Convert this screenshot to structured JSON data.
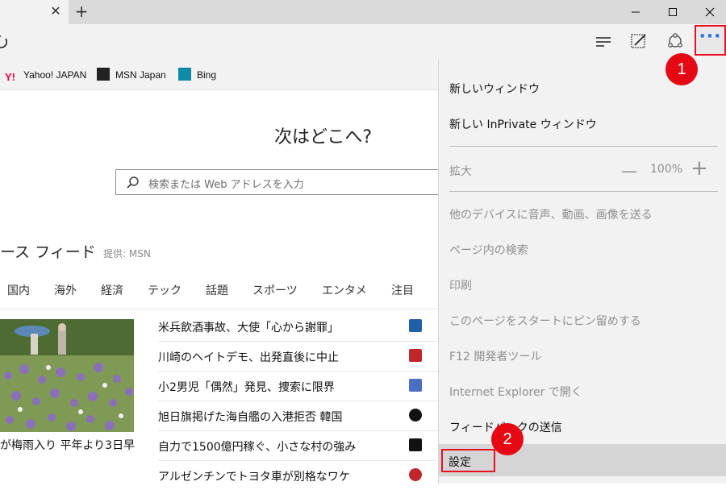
{
  "window": {
    "tab_close": "✕",
    "new_tab": "+"
  },
  "favorites": [
    {
      "label": "Yahoo! JAPAN",
      "icon": "yahoo-icon",
      "color": "#ff0033"
    },
    {
      "label": "MSN Japan",
      "icon": "msn-icon",
      "color": "#222222"
    },
    {
      "label": "Bing",
      "icon": "bing-icon",
      "color": "#0f8ba6"
    }
  ],
  "page": {
    "heading": "次はどこへ?",
    "search_placeholder": "検索または Web アドレスを入力",
    "news_title": "ース フィード",
    "news_source": "提供: MSN",
    "categories": [
      "国内",
      "海外",
      "経済",
      "テック",
      "話題",
      "スポーツ",
      "エンタメ",
      "注目"
    ],
    "photo_caption": "が梅雨入り 平年より3日早",
    "headlines": [
      {
        "text": "米兵飲酒事故、大使「心から謝罪」",
        "source_color": "#1f5fa8"
      },
      {
        "text": "川崎のヘイトデモ、出発直後に中止",
        "source_color": "#c0272d"
      },
      {
        "text": "小2男児「偶然」発見、捜索に限界",
        "source_color": "#4a6fc0"
      },
      {
        "text": "旭日旗掲げた海自艦の入港拒否 韓国",
        "source_color": "#111111"
      },
      {
        "text": "自力で1500億円稼ぐ、小さな村の強み",
        "source_color": "#111111"
      },
      {
        "text": "アルゼンチンでトヨタ車が別格なワケ",
        "source_color": "#c0272d"
      }
    ]
  },
  "menu": {
    "new_window": "新しいウィンドウ",
    "new_inprivate": "新しい InPrivate ウィンドウ",
    "zoom_label": "拡大",
    "zoom_minus": "—",
    "zoom_value": "100%",
    "zoom_plus": "+",
    "cast": "他のデバイスに音声、動画、画像を送る",
    "find": "ページ内の検索",
    "print": "印刷",
    "pin": "このページをスタートにピン留めする",
    "devtools": "F12 開発者ツール",
    "open_ie": "Internet Explorer で開く",
    "feedback": "フィードバックの送信",
    "settings": "設定"
  },
  "annotations": {
    "step1": "1",
    "step2": "2",
    "color": "#e50914"
  },
  "colors": {
    "accent": "#1e74d4",
    "highlight_border": "#e81123"
  }
}
